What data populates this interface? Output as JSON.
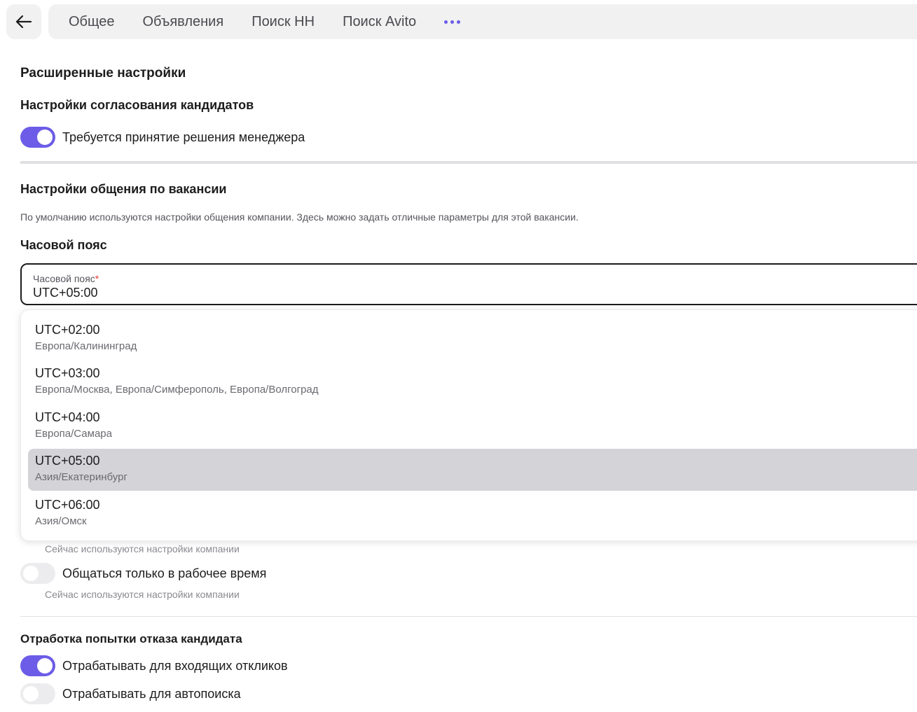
{
  "nav": {
    "tabs": [
      "Общее",
      "Объявления",
      "Поиск HH",
      "Поиск Avito"
    ],
    "more_icon": "more-horizontal-icon",
    "back_icon": "arrow-left-icon"
  },
  "advanced": {
    "title": "Расширенные настройки"
  },
  "approval": {
    "title": "Настройки согласования кандидатов",
    "manager_decision": {
      "label": "Требуется принятие решения менеджера",
      "enabled": true
    }
  },
  "communication": {
    "title": "Настройки общения по вакансии",
    "description": "По умолчанию используются настройки общения компании. Здесь можно задать отличные параметры для этой вакансии.",
    "timezone_heading": "Часовой пояс",
    "timezone_field": {
      "label": "Часовой пояс",
      "required_mark": "*",
      "value": "UTC+05:00"
    },
    "timezone_options": [
      {
        "offset": "UTC+02:00",
        "zones": "Европа/Калининград",
        "selected": false
      },
      {
        "offset": "UTC+03:00",
        "zones": "Европа/Москва, Европа/Симферополь, Европа/Волгоград",
        "selected": false
      },
      {
        "offset": "UTC+04:00",
        "zones": "Европа/Самара",
        "selected": false
      },
      {
        "offset": "UTC+05:00",
        "zones": "Азия/Екатеринбург",
        "selected": true
      },
      {
        "offset": "UTC+06:00",
        "zones": "Азия/Омск",
        "selected": false
      }
    ],
    "hint_1": "Сейчас используются настройки компании",
    "work_hours_only": {
      "label": "Общаться только в рабочее время",
      "enabled": false
    },
    "hint_2": "Сейчас используются настройки компании"
  },
  "rejection": {
    "title": "Отработка попытки отказа кандидата",
    "incoming": {
      "label": "Отрабатывать для входящих откликов",
      "enabled": true
    },
    "autosearch": {
      "label": "Отрабатывать для автопоиска",
      "enabled": false
    }
  },
  "colors": {
    "accent": "#6c5ce7",
    "toggle_off": "#ececee",
    "selected_option": "#d4d4d8",
    "required": "#e53935"
  }
}
